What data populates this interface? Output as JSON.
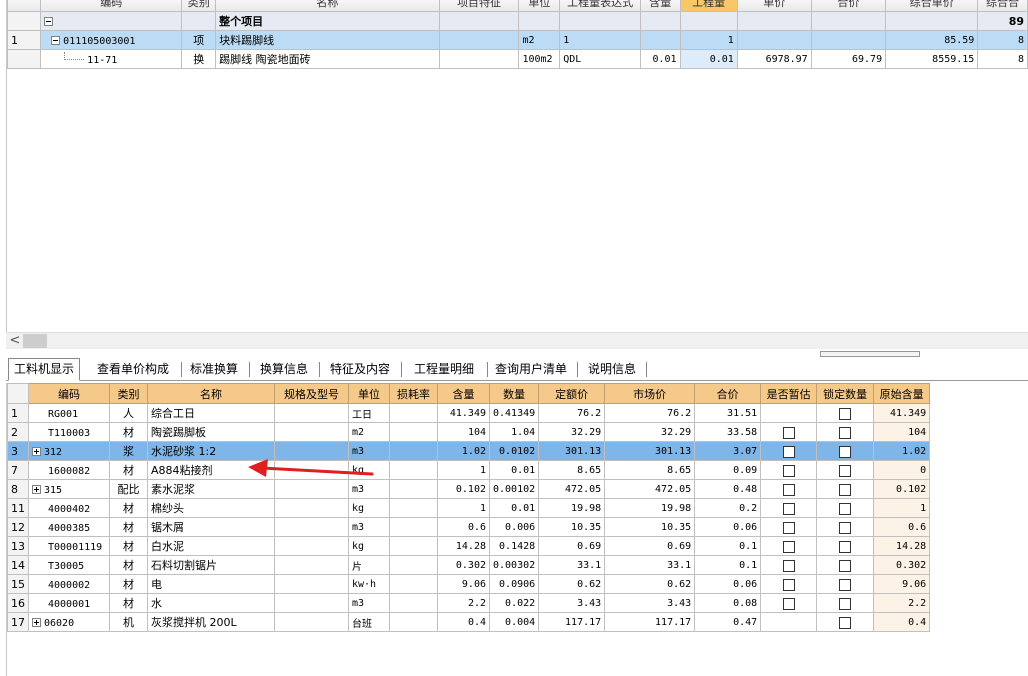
{
  "top_grid": {
    "headers": [
      "",
      "编码",
      "类别",
      "名称",
      "项目特征",
      "单位",
      "工程量表达式",
      "含量",
      "工程量",
      "单价",
      "合价",
      "综合单价",
      "综合合"
    ],
    "rows": [
      {
        "idx": "",
        "code": "",
        "type": "",
        "name": "整个项目",
        "feature": "",
        "unit": "",
        "expr": "",
        "content": "",
        "qty": "",
        "price": "",
        "total": "",
        "unit_price": "",
        "comp_total": "89"
      },
      {
        "idx": "1",
        "code": "011105003001",
        "type": "项",
        "name": "块料踢脚线",
        "feature": "",
        "unit": "m2",
        "expr": "1",
        "content": "",
        "qty": "1",
        "price": "",
        "total": "",
        "unit_price": "85.59",
        "comp_total": "8"
      },
      {
        "idx": "",
        "code": "11-71",
        "type": "换",
        "name": "踢脚线 陶瓷地面砖",
        "feature": "",
        "unit": "100m2",
        "expr": "QDL",
        "content": "0.01",
        "qty": "0.01",
        "price": "6978.97",
        "total": "69.79",
        "unit_price": "8559.15",
        "comp_total": "8"
      }
    ]
  },
  "scroll": {
    "left_arrow": "<"
  },
  "tabs": [
    "工料机显示",
    "查看单价构成",
    "标准换算",
    "换算信息",
    "特征及内容",
    "工程量明细",
    "查询用户清单",
    "说明信息"
  ],
  "bottom_grid": {
    "headers": [
      "编码",
      "类别",
      "名称",
      "规格及型号",
      "单位",
      "损耗率",
      "含量",
      "数量",
      "定额价",
      "市场价",
      "合价",
      "是否暂估",
      "锁定数量",
      "原始含量"
    ],
    "rows": [
      {
        "idx": "1",
        "code": "RG001",
        "type": "人",
        "name": "综合工日",
        "spec": "",
        "unit": "工日",
        "loss": "",
        "content": "41.349",
        "qty": "0.41349",
        "quota": "76.2",
        "market": "76.2",
        "total": "31.51",
        "est": false,
        "lock": true,
        "orig": "41.349"
      },
      {
        "idx": "2",
        "code": "T110003",
        "type": "材",
        "name": "陶瓷踢脚板",
        "spec": "",
        "unit": "m2",
        "loss": "",
        "content": "104",
        "qty": "1.04",
        "quota": "32.29",
        "market": "32.29",
        "total": "33.58",
        "est": true,
        "lock": true,
        "orig": "104"
      },
      {
        "idx": "3",
        "code": "312",
        "type": "浆",
        "name": "水泥砂浆 1:2",
        "spec": "",
        "unit": "m3",
        "loss": "",
        "content": "1.02",
        "qty": "0.0102",
        "quota": "301.13",
        "market": "301.13",
        "total": "3.07",
        "est": true,
        "lock": true,
        "orig": "1.02",
        "expand": true,
        "selected": true
      },
      {
        "idx": "7",
        "code": "1600082",
        "type": "材",
        "name": "A884粘接剂",
        "spec": "",
        "unit": "kg",
        "loss": "",
        "content": "1",
        "qty": "0.01",
        "quota": "8.65",
        "market": "8.65",
        "total": "0.09",
        "est": true,
        "lock": true,
        "orig": "0"
      },
      {
        "idx": "8",
        "code": "315",
        "type": "配比",
        "name": "素水泥浆",
        "spec": "",
        "unit": "m3",
        "loss": "",
        "content": "0.102",
        "qty": "0.00102",
        "quota": "472.05",
        "market": "472.05",
        "total": "0.48",
        "est": true,
        "lock": true,
        "orig": "0.102",
        "expand": true
      },
      {
        "idx": "11",
        "code": "4000402",
        "type": "材",
        "name": "棉纱头",
        "spec": "",
        "unit": "kg",
        "loss": "",
        "content": "1",
        "qty": "0.01",
        "quota": "19.98",
        "market": "19.98",
        "total": "0.2",
        "est": true,
        "lock": true,
        "orig": "1"
      },
      {
        "idx": "12",
        "code": "4000385",
        "type": "材",
        "name": "锯木屑",
        "spec": "",
        "unit": "m3",
        "loss": "",
        "content": "0.6",
        "qty": "0.006",
        "quota": "10.35",
        "market": "10.35",
        "total": "0.06",
        "est": true,
        "lock": true,
        "orig": "0.6"
      },
      {
        "idx": "13",
        "code": "T00001119",
        "type": "材",
        "name": "白水泥",
        "spec": "",
        "unit": "kg",
        "loss": "",
        "content": "14.28",
        "qty": "0.1428",
        "quota": "0.69",
        "market": "0.69",
        "total": "0.1",
        "est": true,
        "lock": true,
        "orig": "14.28"
      },
      {
        "idx": "14",
        "code": "T30005",
        "type": "材",
        "name": "石料切割锯片",
        "spec": "",
        "unit": "片",
        "loss": "",
        "content": "0.302",
        "qty": "0.00302",
        "quota": "33.1",
        "market": "33.1",
        "total": "0.1",
        "est": true,
        "lock": true,
        "orig": "0.302"
      },
      {
        "idx": "15",
        "code": "4000002",
        "type": "材",
        "name": "电",
        "spec": "",
        "unit": "kw·h",
        "loss": "",
        "content": "9.06",
        "qty": "0.0906",
        "quota": "0.62",
        "market": "0.62",
        "total": "0.06",
        "est": true,
        "lock": true,
        "orig": "9.06"
      },
      {
        "idx": "16",
        "code": "4000001",
        "type": "材",
        "name": "水",
        "spec": "",
        "unit": "m3",
        "loss": "",
        "content": "2.2",
        "qty": "0.022",
        "quota": "3.43",
        "market": "3.43",
        "total": "0.08",
        "est": true,
        "lock": true,
        "orig": "2.2"
      },
      {
        "idx": "17",
        "code": "06020",
        "type": "机",
        "name": "灰浆搅拌机 200L",
        "spec": "",
        "unit": "台班",
        "loss": "",
        "content": "0.4",
        "qty": "0.004",
        "quota": "117.17",
        "market": "117.17",
        "total": "0.47",
        "est": false,
        "lock": true,
        "orig": "0.4",
        "expand": true
      }
    ]
  },
  "colors": {
    "header_orange": "#f5c98a",
    "selected_blue": "#7fb6ea",
    "annotation_red": "#e02020"
  }
}
